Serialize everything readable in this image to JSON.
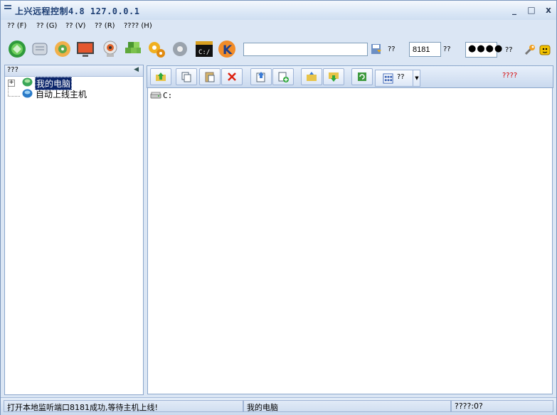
{
  "window": {
    "title": "上兴远程控制4.8 127.0.0.1",
    "minimize_glyph": "_",
    "maximize_glyph": "□",
    "close_glyph": "x"
  },
  "menu": [
    "?? (F)",
    "?? (G)",
    "?? (V)",
    "?? (R)",
    "???? (H)"
  ],
  "toolbar": {
    "icons": [
      "globe-icon",
      "scroll-icon",
      "network-icon",
      "monitor-icon",
      "webcam-icon",
      "cubes-icon",
      "gears-icon",
      "settings-gear-icon",
      "cmd-icon",
      "k-tool-icon"
    ],
    "host_value": "",
    "save_label": "??",
    "port_value": "8181",
    "port_label": "??",
    "password_value": "●●●●",
    "password_label": "??"
  },
  "left_panel": {
    "header": "???",
    "tree": [
      {
        "label": "我的电脑",
        "selected": true
      },
      {
        "label": "自动上线主机",
        "selected": false
      }
    ]
  },
  "right_panel": {
    "view_label": "??",
    "status_text": "????",
    "status_color": "#d40000",
    "files": [
      {
        "name": "C:"
      }
    ]
  },
  "statusbar": {
    "message": "打开本地监听端口8181成功,等待主机上线!",
    "current": "我的电脑",
    "count": "????:0?"
  }
}
